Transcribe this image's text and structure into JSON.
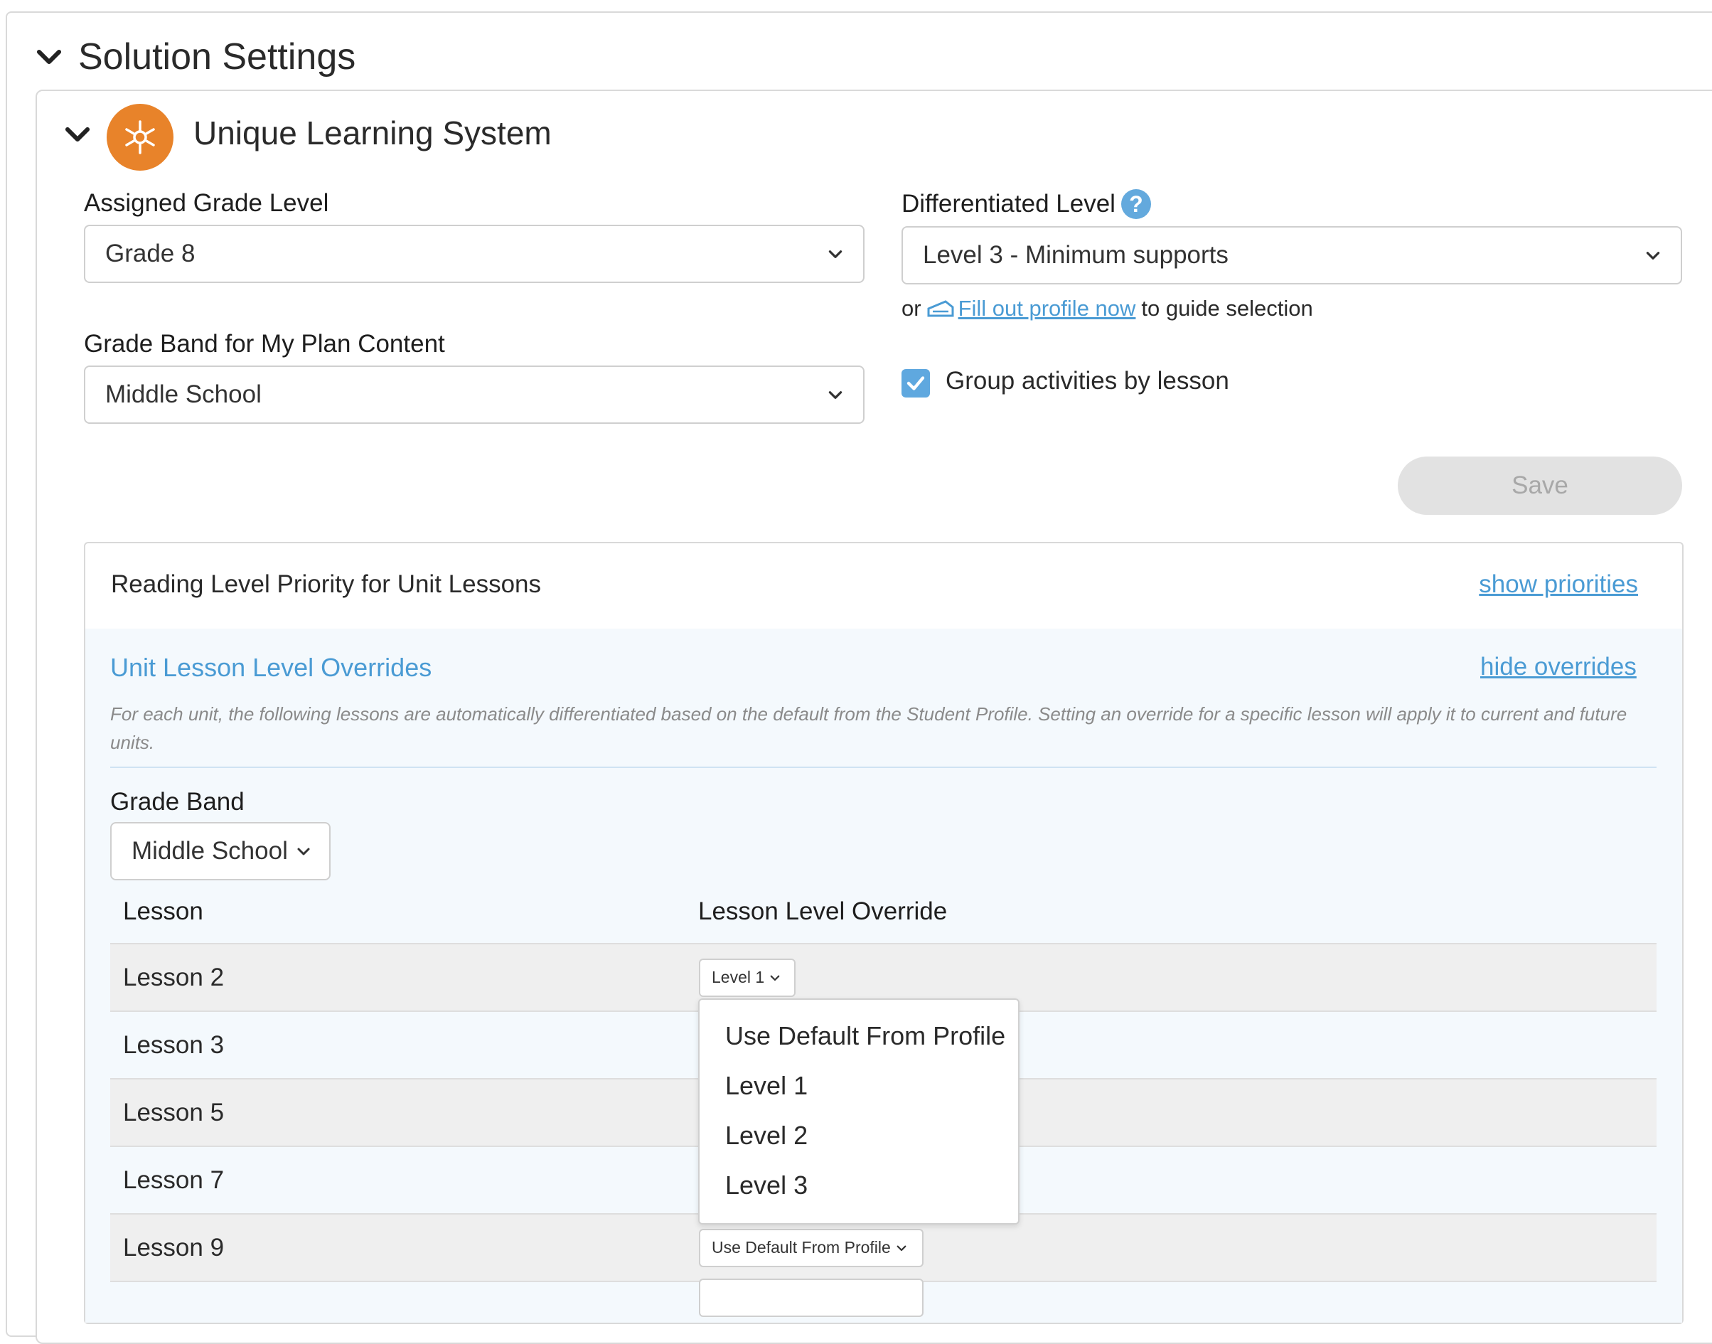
{
  "section": {
    "title": "Solution Settings"
  },
  "solution": {
    "title": "Unique Learning System"
  },
  "assigned_grade": {
    "label": "Assigned Grade Level",
    "value": "Grade 8"
  },
  "grade_band_plan": {
    "label": "Grade Band for My Plan Content",
    "value": "Middle School"
  },
  "differentiated": {
    "label": "Differentiated Level",
    "value": "Level 3 - Minimum supports",
    "or_text": "or",
    "profile_link": "Fill out profile now",
    "guide_text": "to guide selection"
  },
  "group_activities": {
    "label": "Group activities by lesson",
    "checked": true
  },
  "save": {
    "label": "Save"
  },
  "priority": {
    "title": "Reading Level Priority for Unit Lessons",
    "show_link": "show priorities"
  },
  "overrides": {
    "title": "Unit Lesson Level Overrides",
    "hide_link": "hide overrides",
    "description_line1": "For each unit, the following lessons are automatically differentiated based on the default from the Student Profile. Setting an override for a specific lesson will apply it to current and future",
    "description_line2": "units.",
    "grade_band_label": "Grade Band",
    "grade_band_value": "Middle School",
    "col_lesson": "Lesson",
    "col_override": "Lesson Level Override",
    "rows": [
      {
        "lesson": "Lesson 2",
        "override": "Level 1"
      },
      {
        "lesson": "Lesson 3",
        "override": ""
      },
      {
        "lesson": "Lesson 5",
        "override": ""
      },
      {
        "lesson": "Lesson 7",
        "override": ""
      },
      {
        "lesson": "Lesson 9",
        "override": "Use Default From Profile"
      }
    ],
    "dropdown_options": [
      "Use Default From Profile",
      "Level 1",
      "Level 2",
      "Level 3"
    ]
  },
  "colors": {
    "accent": "#4a9bd4",
    "logo": "#e8832a",
    "checkbox": "#5fa8df",
    "save_disabled": "#e2e2e2"
  },
  "icons": [
    "chevron-down-icon",
    "snowflake-logo-icon",
    "help-icon",
    "profile-icon",
    "check-icon"
  ]
}
